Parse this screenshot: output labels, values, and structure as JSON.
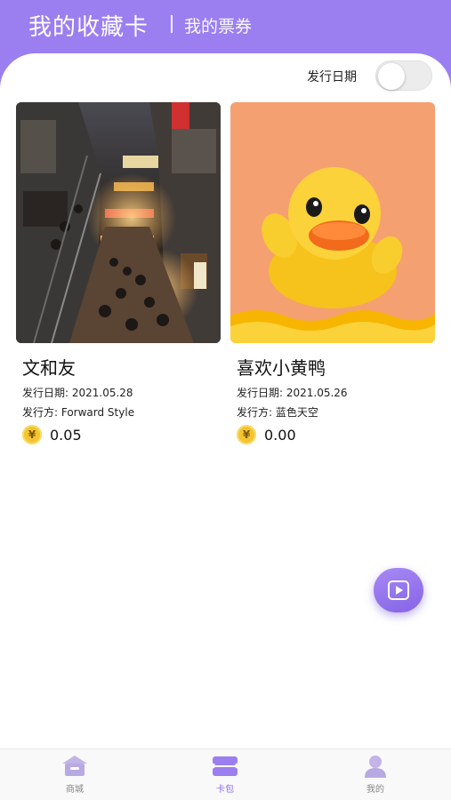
{
  "header": {
    "title": "我的收藏卡",
    "subtitle": "我的票券"
  },
  "filter": {
    "label": "发行日期",
    "toggle_on": false
  },
  "cards": [
    {
      "title": "文和友",
      "date": "发行日期: 2021.05.28",
      "issuer": "发行方: Forward Style",
      "currency_symbol": "¥",
      "price": "0.05",
      "image": "night-street-photo"
    },
    {
      "title": "喜欢小黄鸭",
      "date": "发行日期: 2021.05.26",
      "issuer": "发行方: 蓝色天空",
      "currency_symbol": "¥",
      "price": "0.00",
      "image": "yellow-duck-illustration"
    }
  ],
  "fab": {
    "icon": "play-video-icon"
  },
  "tabs": [
    {
      "label": "商城",
      "icon": "shop-icon",
      "active": false
    },
    {
      "label": "卡包",
      "icon": "card-wallet-icon",
      "active": true
    },
    {
      "label": "我的",
      "icon": "user-icon",
      "active": false
    }
  ],
  "colors": {
    "accent": "#9b7ff0",
    "coin": "#f4c430",
    "duck_background": "#f5a070"
  }
}
